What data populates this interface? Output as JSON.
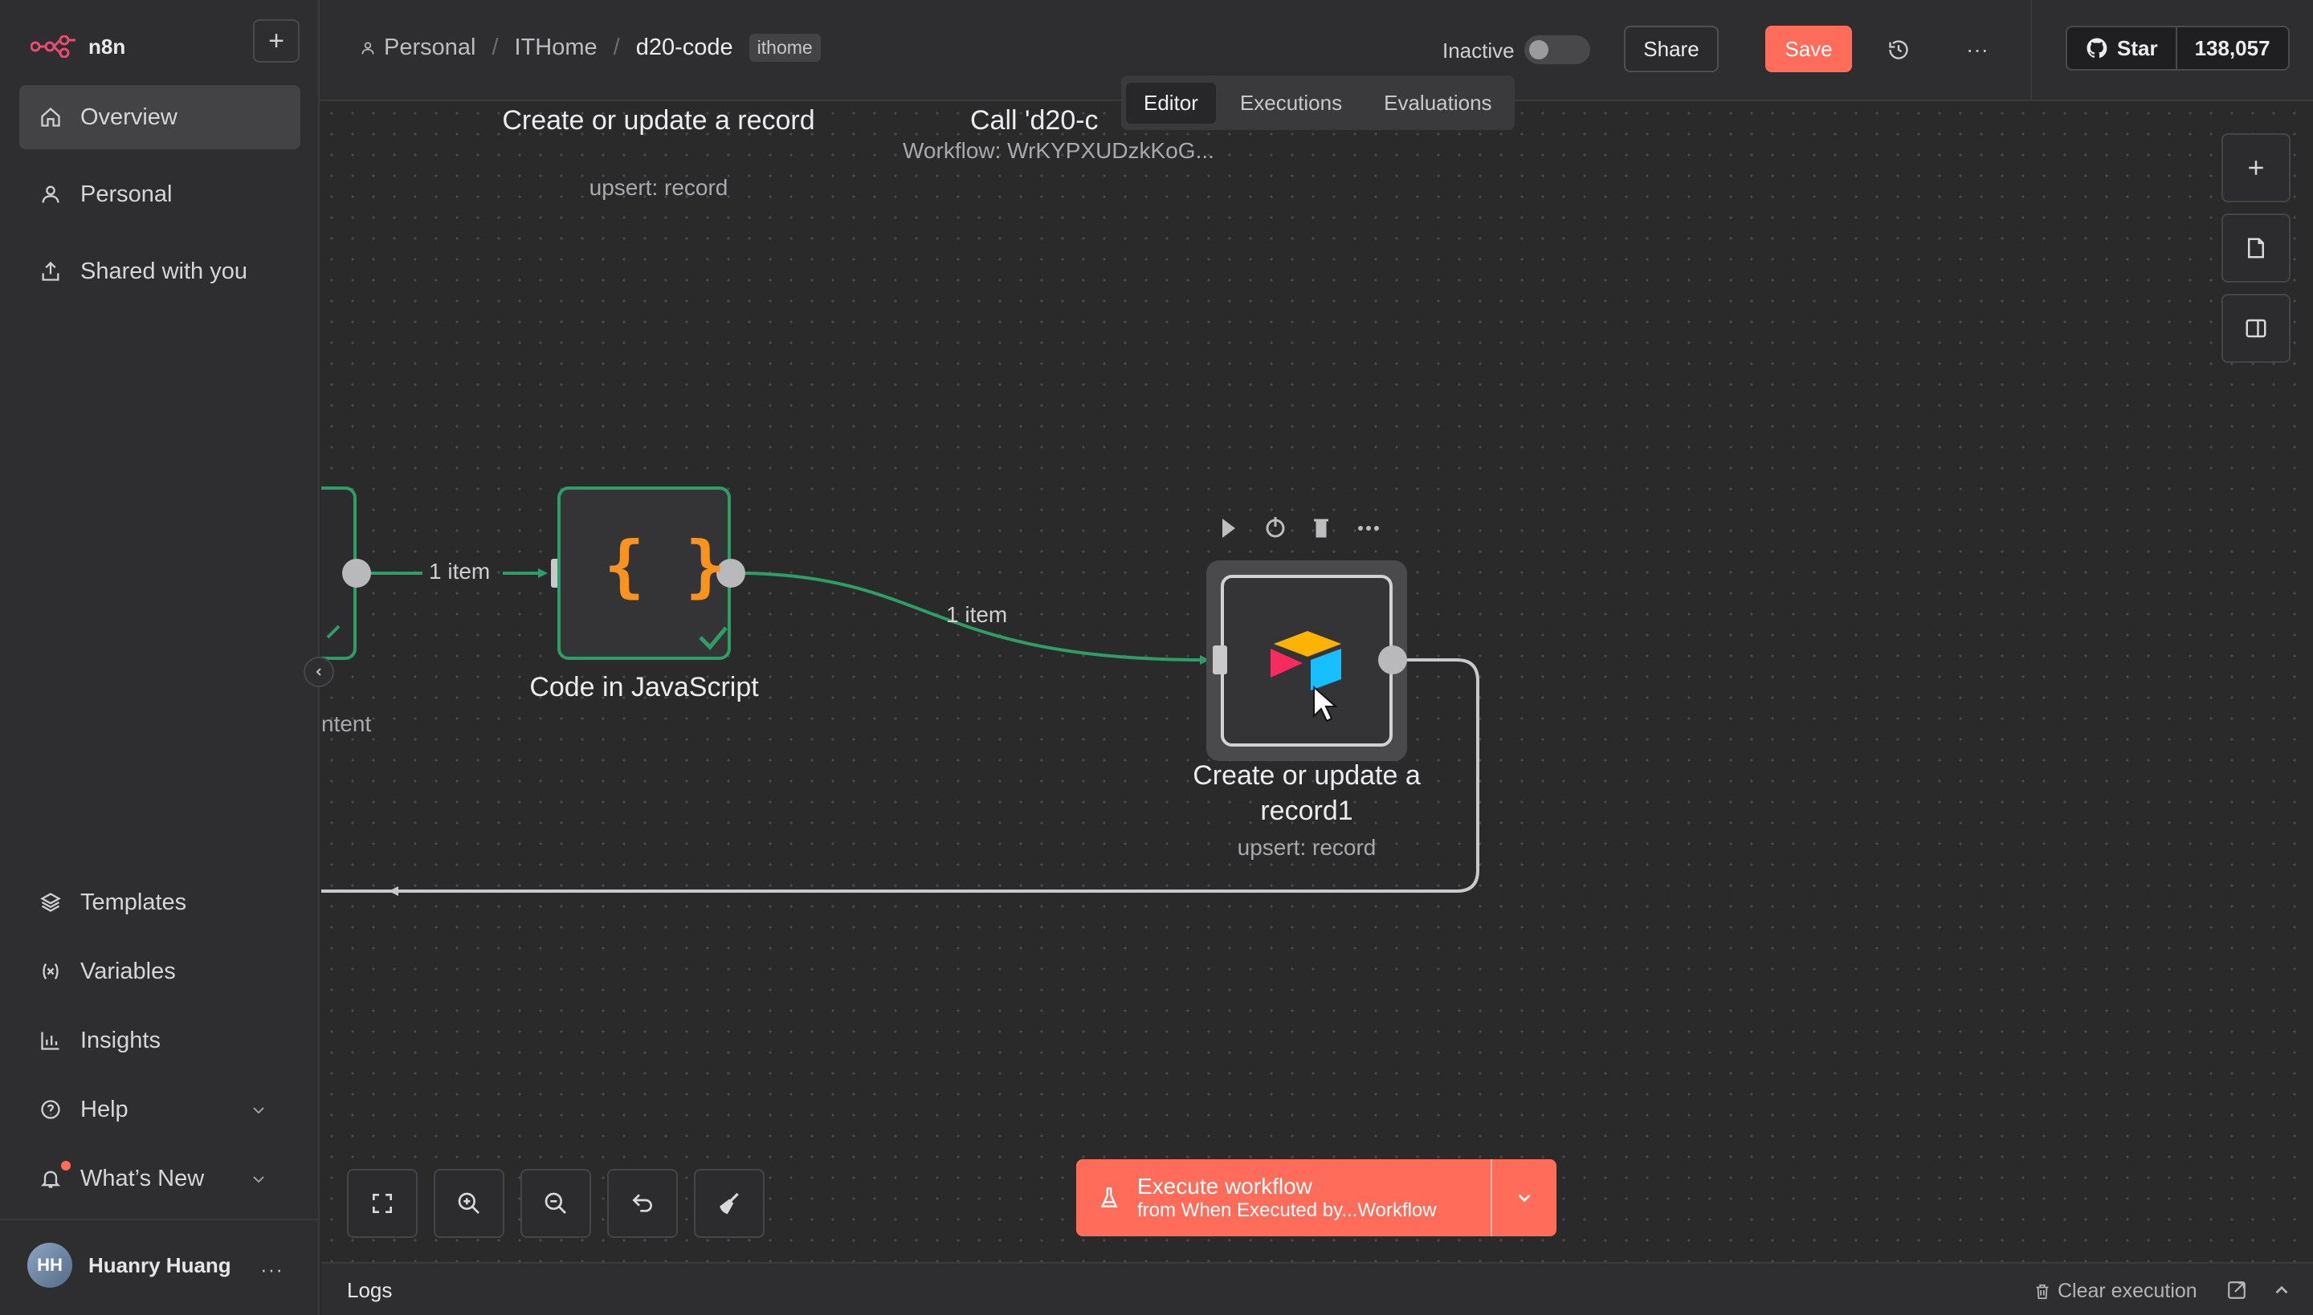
{
  "app": {
    "name": "n8n"
  },
  "sidebar": {
    "add_label": "+",
    "items": [
      {
        "label": "Overview",
        "icon": "home-icon"
      },
      {
        "label": "Personal",
        "icon": "user-icon"
      },
      {
        "label": "Shared with you",
        "icon": "share-icon"
      }
    ],
    "bottom_items": [
      {
        "label": "Templates",
        "icon": "templates-icon"
      },
      {
        "label": "Variables",
        "icon": "variables-icon"
      },
      {
        "label": "Insights",
        "icon": "insights-icon"
      },
      {
        "label": "Help",
        "icon": "help-icon"
      },
      {
        "label": "What’s New",
        "icon": "bell-icon"
      }
    ],
    "user": {
      "initials": "HH",
      "name": "Huanry Huang"
    }
  },
  "header": {
    "breadcrumb": {
      "personal": "Personal",
      "project": "ITHome",
      "workflow": "d20-code"
    },
    "tag": "ithome",
    "status_label": "Inactive",
    "active": false,
    "share_label": "Share",
    "save_label": "Save",
    "github": {
      "star_label": "Star",
      "count": "138,057"
    }
  },
  "tabs": [
    {
      "label": "Editor",
      "active": true
    },
    {
      "label": "Executions",
      "active": false
    },
    {
      "label": "Evaluations",
      "active": false
    }
  ],
  "canvas": {
    "top_nodes": [
      {
        "title": "Create or update a record",
        "subtitle": "upsert: record"
      },
      {
        "title": "Call 'd20-c",
        "subtitle": "Workflow: WrKYPXUDzkKoG..."
      }
    ],
    "left_partial_subtitle": "ntent",
    "nodes": [
      {
        "title": "Code in JavaScript",
        "glyph": "{ }",
        "status": "success"
      },
      {
        "title": "Create or update a record1",
        "subtitle": "upsert: record"
      }
    ],
    "edge_labels": [
      "1 item",
      "1 item"
    ]
  },
  "execute": {
    "title": "Execute workflow",
    "subtitle": "from When Executed by...Workflow"
  },
  "logs": {
    "label": "Logs",
    "clear_label": "Clear execution"
  },
  "colors": {
    "accent": "#ff6d5a",
    "success": "#2f9e66",
    "canvas": "#2a2a2b"
  }
}
